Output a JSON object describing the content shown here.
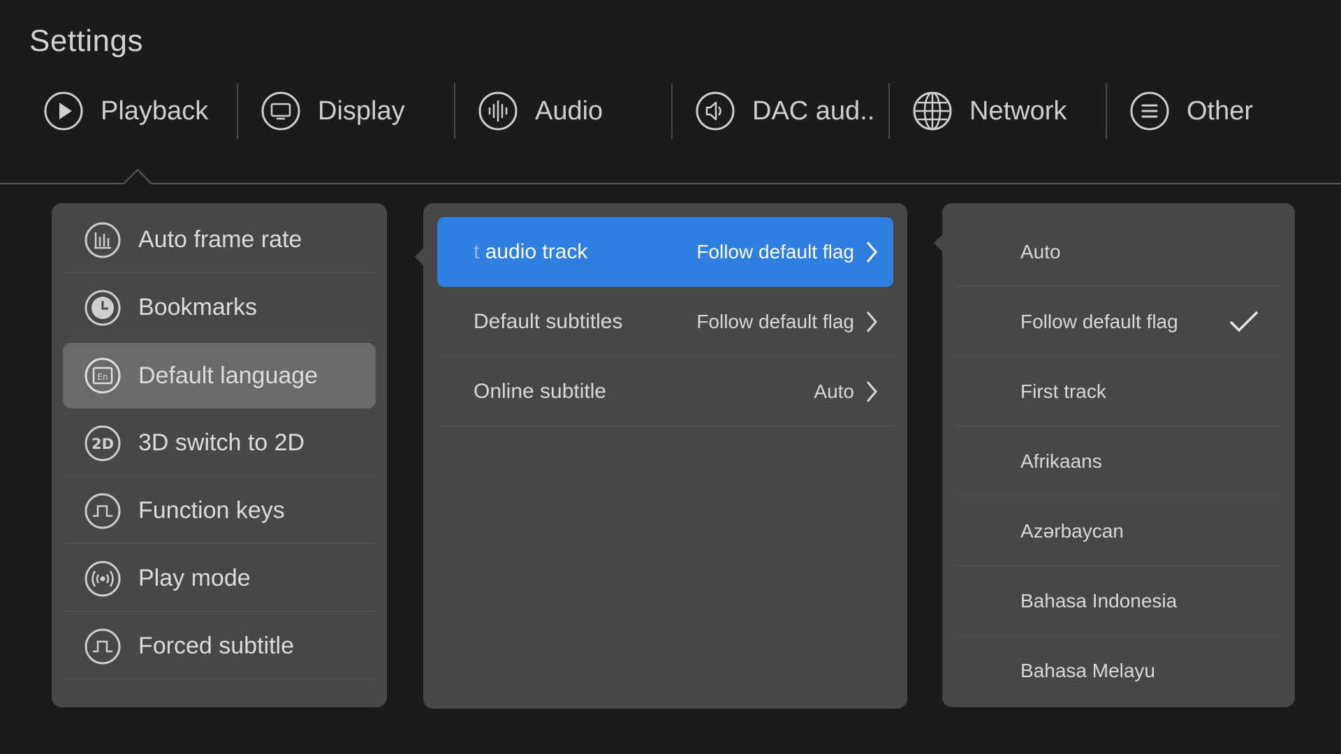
{
  "header": {
    "title": "Settings"
  },
  "tabs": [
    {
      "label": "Playback",
      "icon": "play-icon"
    },
    {
      "label": "Display",
      "icon": "monitor-icon"
    },
    {
      "label": "Audio",
      "icon": "audio-wave-icon"
    },
    {
      "label": "DAC aud..",
      "icon": "speaker-icon"
    },
    {
      "label": "Network",
      "icon": "globe-icon"
    },
    {
      "label": "Other",
      "icon": "menu-icon"
    }
  ],
  "playback_menu": {
    "items": [
      {
        "label": "Auto frame rate",
        "icon": "bar-chart-icon"
      },
      {
        "label": "Bookmarks",
        "icon": "clock-icon"
      },
      {
        "label": "Default language",
        "icon": "language-icon"
      },
      {
        "label": "3D switch to 2D",
        "icon": "2d-icon"
      },
      {
        "label": "Function keys",
        "icon": "pulse-icon"
      },
      {
        "label": "Play mode",
        "icon": "broadcast-icon"
      },
      {
        "label": "Forced subtitle",
        "icon": "pulse-icon"
      }
    ],
    "selected": "Default language"
  },
  "language_menu": {
    "items": [
      {
        "label_faint": "t",
        "label": "audio track",
        "value": "Follow default flag"
      },
      {
        "label": "Default subtitles",
        "value": "Follow default flag"
      },
      {
        "label": "Online subtitle",
        "value": "Auto"
      }
    ]
  },
  "options": {
    "items": [
      {
        "label": "Auto"
      },
      {
        "label": "Follow default flag"
      },
      {
        "label": "First track"
      },
      {
        "label": "Afrikaans"
      },
      {
        "label": "Azərbaycan"
      },
      {
        "label": "Bahasa Indonesia"
      },
      {
        "label": "Bahasa Melayu"
      }
    ],
    "checked": "Follow default flag"
  },
  "colors": {
    "background": "#1b1b1b",
    "panel": "#474747",
    "accent": "#2e7fe0",
    "selected_row": "#6a6a6a"
  }
}
